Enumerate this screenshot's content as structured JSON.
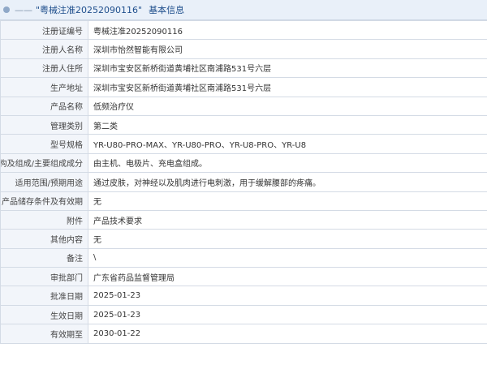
{
  "header": {
    "dash": "——",
    "registration_quoted": "\"粤械注准20252090116\"",
    "title": "基本信息"
  },
  "rows": [
    {
      "label": "注册证编号",
      "value": "粤械注准20252090116"
    },
    {
      "label": "注册人名称",
      "value": "深圳市怡然智能有限公司"
    },
    {
      "label": "注册人住所",
      "value": "深圳市宝安区新桥街道黄埔社区南浦路531号六层"
    },
    {
      "label": "生产地址",
      "value": "深圳市宝安区新桥街道黄埔社区南浦路531号六层"
    },
    {
      "label": "产品名称",
      "value": "低频治疗仪"
    },
    {
      "label": "管理类别",
      "value": "第二类"
    },
    {
      "label": "型号规格",
      "value": "YR-U80-PRO-MAX、YR-U80-PRO、YR-U8-PRO、YR-U8"
    },
    {
      "label": "结构及组成/主要组成成分",
      "value": "由主机、电极片、充电盒组成。"
    },
    {
      "label": "适用范围/预期用途",
      "value": "通过皮肤，对神经以及肌肉进行电刺激，用于缓解腰部的疼痛。"
    },
    {
      "label": "产品储存条件及有效期",
      "value": "无"
    },
    {
      "label": "附件",
      "value": "产品技术要求"
    },
    {
      "label": "其他内容",
      "value": "无"
    },
    {
      "label": "备注",
      "value": "\\"
    },
    {
      "label": "审批部门",
      "value": "广东省药品监督管理局"
    },
    {
      "label": "批准日期",
      "value": "2025-01-23"
    },
    {
      "label": "生效日期",
      "value": "2025-01-23"
    },
    {
      "label": "有效期至",
      "value": "2030-01-22"
    }
  ]
}
